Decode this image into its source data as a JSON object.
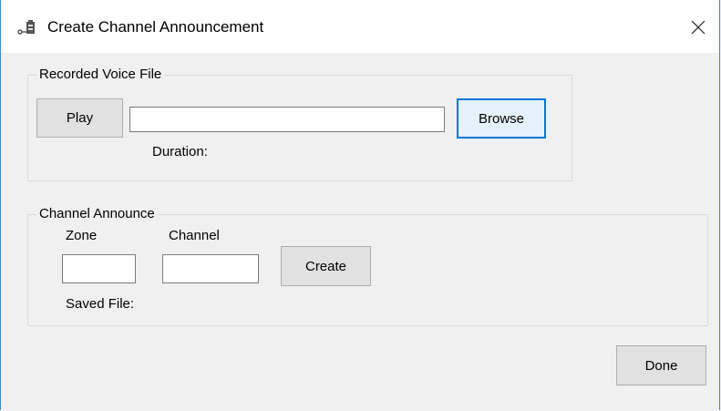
{
  "window": {
    "title": "Create Channel Announcement",
    "icon": "speaker-icon",
    "close_icon": "close-icon"
  },
  "voice_group": {
    "label": "Recorded Voice File",
    "play_label": "Play",
    "file_path_value": "",
    "browse_label": "Browse",
    "duration_label": "Duration:"
  },
  "channel_group": {
    "label": "Channel Announce",
    "zone_label": "Zone",
    "zone_value": "",
    "channel_label": "Channel",
    "channel_value": "",
    "create_label": "Create",
    "saved_file_label": "Saved File:"
  },
  "footer": {
    "done_label": "Done"
  },
  "colors": {
    "accent": "#0078d7",
    "window_border": "#3c8ad6",
    "background": "#f0f0f0"
  }
}
